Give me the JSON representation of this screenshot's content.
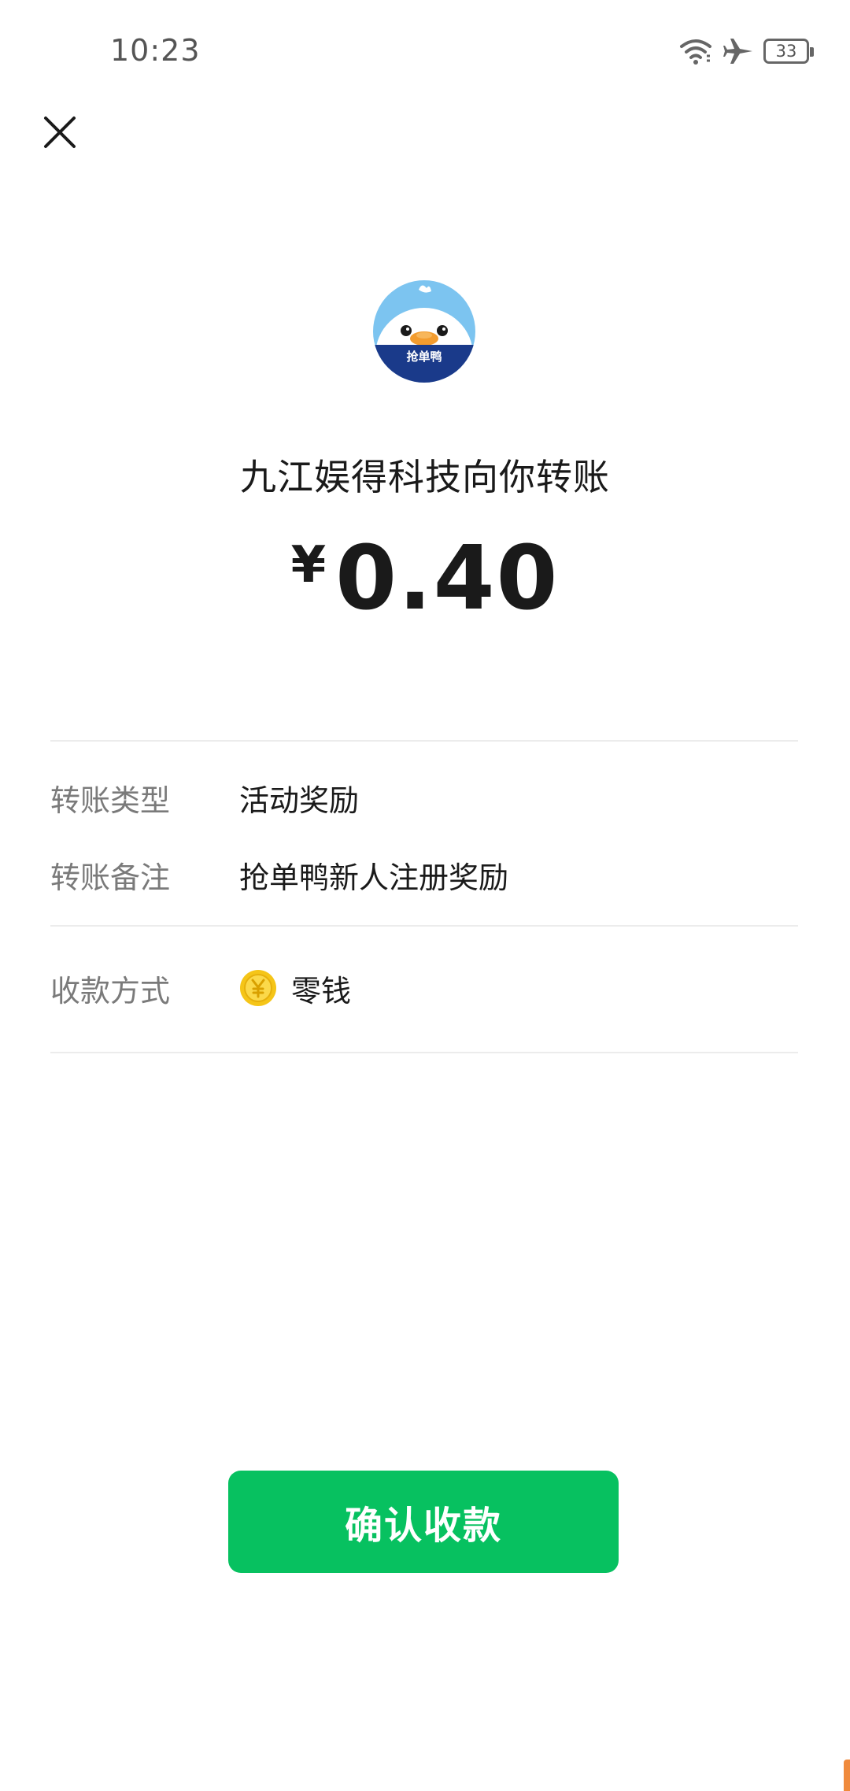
{
  "status_bar": {
    "time": "10:23",
    "battery_level": "33",
    "icons": [
      "wifi-icon",
      "airplane-icon",
      "battery-icon"
    ]
  },
  "header": {
    "close_icon": "close-icon"
  },
  "payer": {
    "avatar_label": "抢单鸭",
    "title": "九江娱得科技向你转账"
  },
  "amount": {
    "currency_symbol": "¥",
    "value": "0.40"
  },
  "details": {
    "transfer_type_label": "转账类型",
    "transfer_type_value": "活动奖励",
    "transfer_note_label": "转账备注",
    "transfer_note_value": "抢单鸭新人注册奖励",
    "payment_method_label": "收款方式",
    "payment_method_value": "零钱",
    "payment_method_icon": "coin-icon"
  },
  "actions": {
    "confirm_label": "确认收款"
  },
  "colors": {
    "accent_green": "#07c160",
    "coin_yellow": "#f5c518",
    "avatar_blue": "#1a3a8a"
  }
}
